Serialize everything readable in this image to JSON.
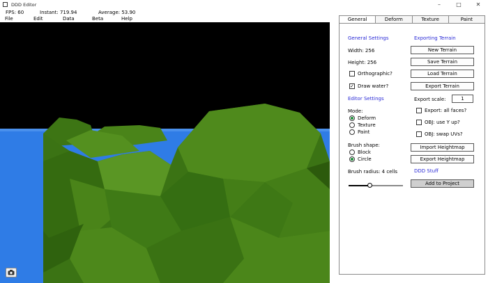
{
  "window": {
    "title": "DDD Editor",
    "minimize_glyph": "–",
    "maximize_glyph": "□",
    "close_glyph": "✕"
  },
  "stats": {
    "fps": "FPS: 60",
    "instant": "Instant: 719.94",
    "average": "Average: 53.90"
  },
  "menu": [
    "File",
    "Edit",
    "Data",
    "Beta",
    "Help"
  ],
  "tabs": [
    {
      "label": "General",
      "active": true
    },
    {
      "label": "Deform",
      "active": false
    },
    {
      "label": "Texture",
      "active": false
    },
    {
      "label": "Paint",
      "active": false
    }
  ],
  "general_settings": {
    "title": "General Settings",
    "width": "Width: 256",
    "height": "Height: 256",
    "orthographic": {
      "label": "Orthographic?",
      "checked": false
    },
    "draw_water": {
      "label": "Draw water?",
      "checked": true
    }
  },
  "editor_settings": {
    "title": "Editor Settings",
    "mode_label": "Mode:",
    "modes": [
      {
        "label": "Deform",
        "selected": true
      },
      {
        "label": "Texture",
        "selected": false
      },
      {
        "label": "Paint",
        "selected": false
      }
    ],
    "brush_shape_label": "Brush shape:",
    "brush_shapes": [
      {
        "label": "Block",
        "selected": false
      },
      {
        "label": "Circle",
        "selected": true
      }
    ],
    "brush_radius": "Brush radius: 4 cells",
    "brush_radius_fraction": 0.38
  },
  "exporting": {
    "title": "Exporting Terrain",
    "new_terrain": "New Terrain",
    "save_terrain": "Save Terrain",
    "load_terrain": "Load Terrain",
    "export_terrain": "Export Terrain",
    "export_scale_label": "Export scale:",
    "export_scale_value": "1",
    "all_faces": {
      "label": "Export: all faces?",
      "checked": false
    },
    "use_y_up": {
      "label": "OBJ: use Y up?",
      "checked": false
    },
    "swap_uvs": {
      "label": "OBJ: swap UVs?",
      "checked": false
    },
    "import_heightmap": "Import Heightmap",
    "export_heightmap": "Export Heightmap"
  },
  "ddd_stuff": {
    "title": "DDD Stuff",
    "add_to_project": "Add to Project"
  },
  "colors": {
    "section_title": "#2b2bd6",
    "sky": "#000000",
    "water": "#2f7ce6",
    "terrain_light": "#4f8a1c",
    "terrain_mid": "#3d7514",
    "terrain_dark": "#2c5a0c",
    "radio_dot": "#1f8f3a"
  },
  "icons": {
    "camera": "camera-icon",
    "window": "app-window-icon"
  }
}
